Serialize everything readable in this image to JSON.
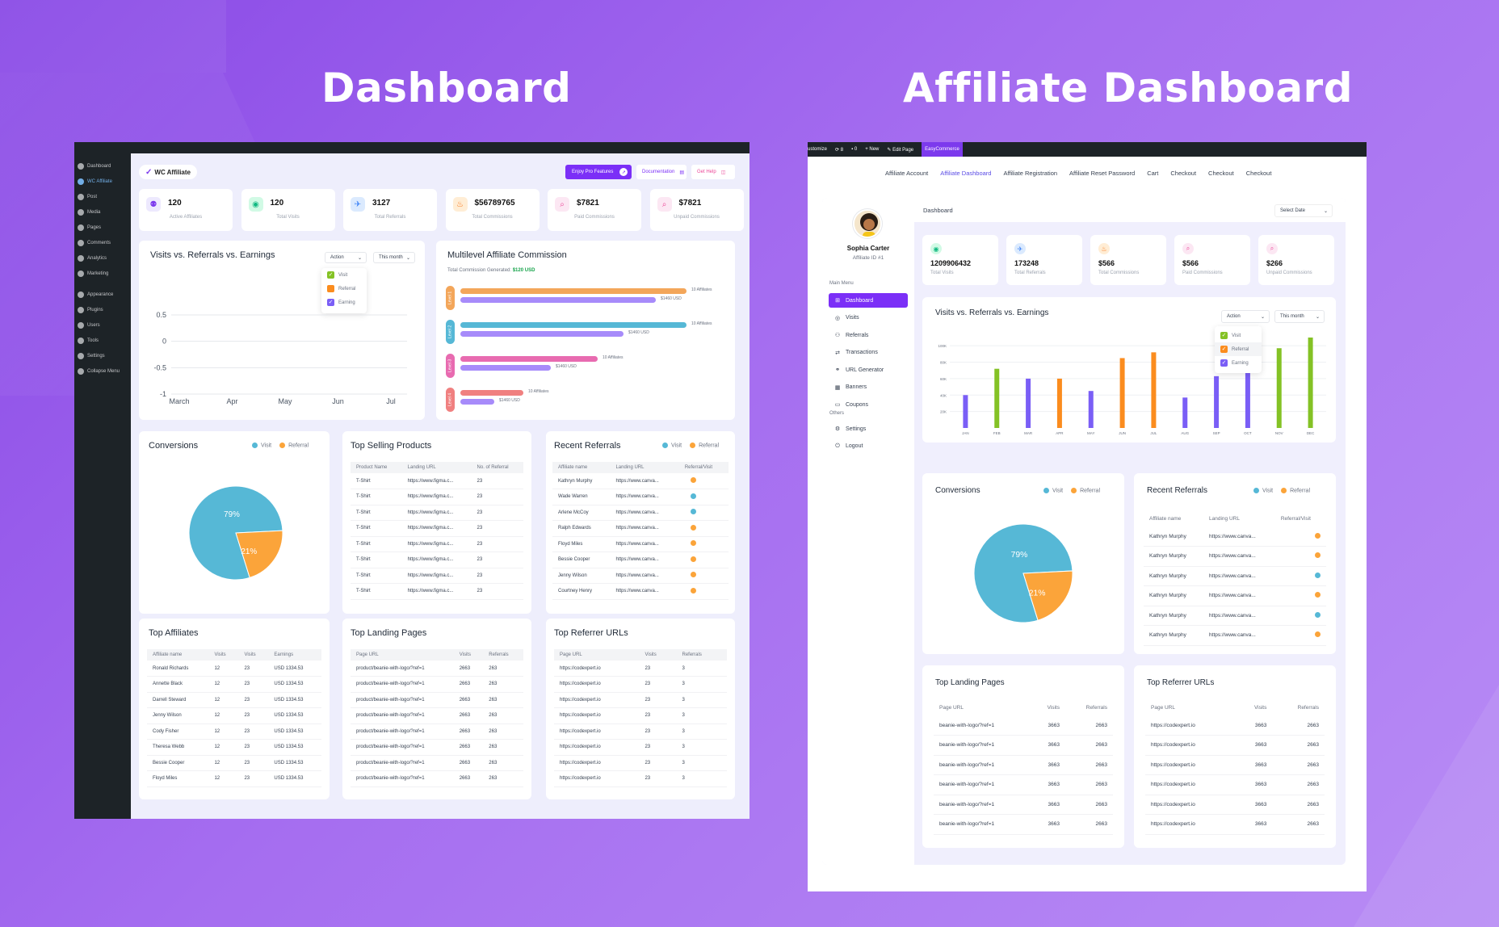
{
  "titles": {
    "left": "Dashboard",
    "right": "Affiliate Dashboard"
  },
  "colors": {
    "primary": "#7b2ff7",
    "visit": "#56b8d6",
    "referral": "#fba43a",
    "earning": "#7a5ef6",
    "green": "#84c225",
    "orange": "#fb8c1e"
  },
  "left": {
    "sidebar": [
      "Dashboard",
      "WC Affiliate",
      "Post",
      "Media",
      "Pages",
      "Comments",
      "Analytics",
      "Marketing",
      "Appearance",
      "Plugins",
      "Users",
      "Tools",
      "Settings",
      "Collapse Menu"
    ],
    "logo": "WC Affiliate",
    "buttons": {
      "pro": "Enjoy Pro Features",
      "doc": "Documentation",
      "help": "Get Help"
    },
    "stats": [
      {
        "value": "120",
        "label": "Active Affiliates",
        "icon": "affiliates-icon"
      },
      {
        "value": "120",
        "label": "Total Visits",
        "icon": "eye-icon"
      },
      {
        "value": "3127",
        "label": "Total Referrals",
        "icon": "referral-icon"
      },
      {
        "value": "$56789765",
        "label": "Total Commissions",
        "icon": "fire-icon"
      },
      {
        "value": "$7821",
        "label": "Paid Commissions",
        "icon": "search-icon"
      },
      {
        "value": "$7821",
        "label": "Unpaid Commissions",
        "icon": "search-icon"
      }
    ],
    "visits_chart": {
      "title": "Visits vs. Referrals vs. Earnings",
      "action": "Action",
      "period": "This month",
      "legend": [
        "Visit",
        "Referral",
        "Earning"
      ]
    },
    "multilevel": {
      "title": "Multilevel Affiliate Commission",
      "total_label": "Total Commission Generated:",
      "total_value": "$120 USD",
      "levels": [
        {
          "label": "Level 1",
          "color": "#f3a65a",
          "affiliates": "10 Affiliates",
          "usd": "$1460 USD"
        },
        {
          "label": "Level 2",
          "color": "#56b8d6",
          "affiliates": "10 Affiliates",
          "usd": "$1460 USD"
        },
        {
          "label": "Level 3",
          "color": "#e86bb0",
          "affiliates": "10 Affiliates",
          "usd": "$1460 USD"
        },
        {
          "label": "Level 4",
          "color": "#f08080",
          "affiliates": "10 Affiliates",
          "usd": "$1460 USD"
        }
      ]
    },
    "conversions": {
      "title": "Conversions",
      "legend": [
        "Visit",
        "Referral"
      ],
      "visit_pct": "79%",
      "referral_pct": "21%"
    },
    "top_products": {
      "title": "Top Selling Products",
      "headers": [
        "Product Name",
        "Landing URL",
        "No. of Referral"
      ],
      "rows": [
        [
          "T-Shirt",
          "https://www.figma.c...",
          "23"
        ],
        [
          "T-Shirt",
          "https://www.figma.c...",
          "23"
        ],
        [
          "T-Shirt",
          "https://www.figma.c...",
          "23"
        ],
        [
          "T-Shirt",
          "https://www.figma.c...",
          "23"
        ],
        [
          "T-Shirt",
          "https://www.figma.c...",
          "23"
        ],
        [
          "T-Shirt",
          "https://www.figma.c...",
          "23"
        ],
        [
          "T-Shirt",
          "https://www.figma.c...",
          "23"
        ],
        [
          "T-Shirt",
          "https://www.figma.c...",
          "23"
        ]
      ]
    },
    "recent_referrals": {
      "title": "Recent Referrals",
      "legend": [
        "Visit",
        "Referral"
      ],
      "headers": [
        "Affiliate name",
        "Landing URL",
        "Referral/Visit"
      ],
      "rows": [
        [
          "Kathryn Murphy",
          "https://www.canva...",
          "referral"
        ],
        [
          "Wade Warren",
          "https://www.canva...",
          "visit"
        ],
        [
          "Arlene McCoy",
          "https://www.canva...",
          "visit"
        ],
        [
          "Ralph Edwards",
          "https://www.canva...",
          "referral"
        ],
        [
          "Floyd Miles",
          "https://www.canva...",
          "referral"
        ],
        [
          "Bessie Cooper",
          "https://www.canva...",
          "referral"
        ],
        [
          "Jenny Wilson",
          "https://www.canva...",
          "referral"
        ],
        [
          "Courtney Henry",
          "https://www.canva...",
          "referral"
        ]
      ]
    },
    "top_affiliates": {
      "title": "Top Affiliates",
      "headers": [
        "Affiliate name",
        "Visits",
        "Visits",
        "Earnings"
      ],
      "rows": [
        [
          "Ronald Richards",
          "12",
          "23",
          "USD 1334.53"
        ],
        [
          "Annette Black",
          "12",
          "23",
          "USD 1334.53"
        ],
        [
          "Darrell Steward",
          "12",
          "23",
          "USD 1334.53"
        ],
        [
          "Jenny Wilson",
          "12",
          "23",
          "USD 1334.53"
        ],
        [
          "Cody Fisher",
          "12",
          "23",
          "USD 1334.53"
        ],
        [
          "Theresa Webb",
          "12",
          "23",
          "USD 1334.53"
        ],
        [
          "Bessie Cooper",
          "12",
          "23",
          "USD 1334.53"
        ],
        [
          "Floyd Miles",
          "12",
          "23",
          "USD 1334.53"
        ]
      ]
    },
    "top_landing": {
      "title": "Top Landing Pages",
      "headers": [
        "Page URL",
        "Visits",
        "Referrals"
      ],
      "rows": [
        [
          "product/beanie-with-logo/?ref=1",
          "2663",
          "263"
        ],
        [
          "product/beanie-with-logo/?ref=1",
          "2663",
          "263"
        ],
        [
          "product/beanie-with-logo/?ref=1",
          "2663",
          "263"
        ],
        [
          "product/beanie-with-logo/?ref=1",
          "2663",
          "263"
        ],
        [
          "product/beanie-with-logo/?ref=1",
          "2663",
          "263"
        ],
        [
          "product/beanie-with-logo/?ref=1",
          "2663",
          "263"
        ],
        [
          "product/beanie-with-logo/?ref=1",
          "2663",
          "263"
        ],
        [
          "product/beanie-with-logo/?ref=1",
          "2663",
          "263"
        ]
      ]
    },
    "top_referrer": {
      "title": "Top Referrer URLs",
      "headers": [
        "Page URL",
        "Visits",
        "Referrals"
      ],
      "rows": [
        [
          "https://codexpert.io",
          "23",
          "3"
        ],
        [
          "https://codexpert.io",
          "23",
          "3"
        ],
        [
          "https://codexpert.io",
          "23",
          "3"
        ],
        [
          "https://codexpert.io",
          "23",
          "3"
        ],
        [
          "https://codexpert.io",
          "23",
          "3"
        ],
        [
          "https://codexpert.io",
          "23",
          "3"
        ],
        [
          "https://codexpert.io",
          "23",
          "3"
        ],
        [
          "https://codexpert.io",
          "23",
          "3"
        ]
      ]
    }
  },
  "right": {
    "adminbar": [
      "ustomize",
      "8",
      "0",
      "New",
      "Edit Page",
      "EasyCommerce"
    ],
    "nav": [
      "Affiliate Account",
      "Affiliate Dashboard",
      "Affiliate Registration",
      "Affiliate Reset Password",
      "Cart",
      "Checkout",
      "Checkout",
      "Checkout"
    ],
    "profile": {
      "name": "Sophia Carter",
      "id": "Affiliate ID #1"
    },
    "main_menu_label": "Main Menu",
    "menu": [
      "Dashboard",
      "Visits",
      "Referrals",
      "Transactions",
      "URL Generator",
      "Banners",
      "Coupons"
    ],
    "others_label": "Others",
    "others": [
      "Settings",
      "Logout"
    ],
    "header_title": "Dashboard",
    "select_date": "Select Date",
    "stats": [
      {
        "value": "1209906432",
        "label": "Total Visits",
        "icon": "eye-icon"
      },
      {
        "value": "173248",
        "label": "Total Referrals",
        "icon": "referral-icon"
      },
      {
        "value": "$566",
        "label": "Total Commissions",
        "icon": "fire-icon"
      },
      {
        "value": "$566",
        "label": "Paid Commissions",
        "icon": "search-icon"
      },
      {
        "value": "$266",
        "label": "Unpaid Commissions",
        "icon": "search-icon"
      }
    ],
    "chart_title": "Visits vs. Referrals vs. Earnings",
    "action": "Action",
    "period": "This month",
    "legend": [
      "Visit",
      "Referral",
      "Earning"
    ],
    "conversions": {
      "title": "Conversions",
      "legend": [
        "Visit",
        "Referral"
      ],
      "visit_pct": "79%",
      "referral_pct": "21%"
    },
    "recent_referrals": {
      "title": "Recent Referrals",
      "legend": [
        "Visit",
        "Referral"
      ],
      "headers": [
        "Affiliate name",
        "Landing URL",
        "Referral/Visit"
      ],
      "rows": [
        [
          "Kathryn Murphy",
          "https://www.canva...",
          "referral"
        ],
        [
          "Kathryn Murphy",
          "https://www.canva...",
          "referral"
        ],
        [
          "Kathryn Murphy",
          "https://www.canva...",
          "visit"
        ],
        [
          "Kathryn Murphy",
          "https://www.canva...",
          "referral"
        ],
        [
          "Kathryn Murphy",
          "https://www.canva...",
          "visit"
        ],
        [
          "Kathryn Murphy",
          "https://www.canva...",
          "referral"
        ]
      ]
    },
    "top_landing": {
      "title": "Top Landing Pages",
      "headers": [
        "Page URL",
        "Visits",
        "Referrals"
      ],
      "rows": [
        [
          "beanie-with-logo/?ref=1",
          "3663",
          "2663"
        ],
        [
          "beanie-with-logo/?ref=1",
          "3663",
          "2663"
        ],
        [
          "beanie-with-logo/?ref=1",
          "3663",
          "2663"
        ],
        [
          "beanie-with-logo/?ref=1",
          "3663",
          "2663"
        ],
        [
          "beanie-with-logo/?ref=1",
          "3663",
          "2663"
        ],
        [
          "beanie-with-logo/?ref=1",
          "3663",
          "2663"
        ]
      ]
    },
    "top_referrer": {
      "title": "Top Referrer URLs",
      "headers": [
        "Page URL",
        "Visits",
        "Referrals"
      ],
      "rows": [
        [
          "https://codexpert.io",
          "3663",
          "2663"
        ],
        [
          "https://codexpert.io",
          "3663",
          "2663"
        ],
        [
          "https://codexpert.io",
          "3663",
          "2663"
        ],
        [
          "https://codexpert.io",
          "3663",
          "2663"
        ],
        [
          "https://codexpert.io",
          "3663",
          "2663"
        ],
        [
          "https://codexpert.io",
          "3663",
          "2663"
        ]
      ]
    }
  },
  "chart_data": [
    {
      "type": "line",
      "title": "Visits vs. Referrals vs. Earnings",
      "categories": [
        "March",
        "Apr",
        "May",
        "Jun",
        "Jul"
      ],
      "yticks": [
        "0.5",
        "0",
        "-0.5",
        "-1"
      ],
      "ylim": [
        -1,
        0.5
      ],
      "series": []
    },
    {
      "type": "bar",
      "title": "Multilevel Affiliate Commission",
      "categories": [
        "Level 1",
        "Level 2",
        "Level 3",
        "Level 4"
      ],
      "series": [
        {
          "name": "Affiliates",
          "values": [
            10,
            10,
            10,
            10
          ]
        },
        {
          "name": "USD",
          "values": [
            1460,
            1460,
            1460,
            1460
          ]
        }
      ]
    },
    {
      "type": "pie",
      "title": "Conversions",
      "categories": [
        "Visit",
        "Referral"
      ],
      "values": [
        79,
        21
      ]
    },
    {
      "type": "bar",
      "title": "Visits vs. Referrals vs. Earnings",
      "categories": [
        "JAN",
        "FEB",
        "MAR",
        "APR",
        "MAY",
        "JUN",
        "JUL",
        "AUG",
        "SEP",
        "OCT",
        "NOV",
        "DEC"
      ],
      "yticks": [
        "100K",
        "80K",
        "60K",
        "40K",
        "20K"
      ],
      "values": [
        40,
        72,
        60,
        60,
        45,
        85,
        92,
        37,
        63,
        73,
        97,
        110
      ],
      "colors": [
        "#7a5ef6",
        "#84c225",
        "#7a5ef6",
        "#fb8c1e",
        "#7a5ef6",
        "#fb8c1e",
        "#fb8c1e",
        "#7a5ef6",
        "#7a5ef6",
        "#7a5ef6",
        "#84c225",
        "#84c225"
      ]
    },
    {
      "type": "pie",
      "title": "Conversions",
      "categories": [
        "Visit",
        "Referral"
      ],
      "values": [
        79,
        21
      ]
    }
  ]
}
